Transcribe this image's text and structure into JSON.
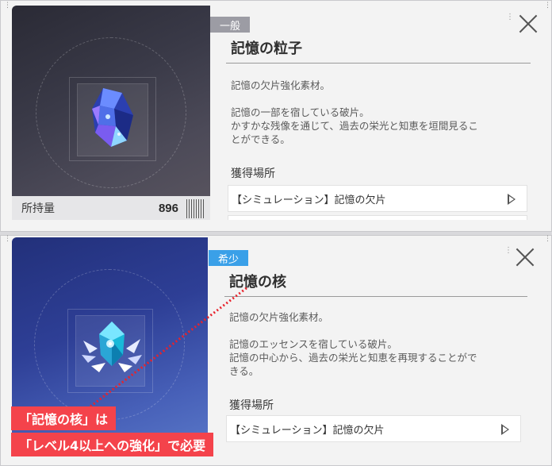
{
  "top_card": {
    "rarity": "一般",
    "title": "記憶の粒子",
    "desc_line1": "記憶の欠片強化素材。",
    "desc_line2": "記憶の一部を宿している破片。",
    "desc_line3": "かすかな残像を通じて、過去の栄光と知恵を垣間見るこ",
    "desc_line4": "とができる。",
    "source_heading": "獲得場所",
    "source_item": "【シミュレーション】記憶の欠片",
    "quantity_label": "所持量",
    "quantity_value": "896",
    "item_icon": "blue-crystal-shard-icon"
  },
  "bottom_card": {
    "rarity": "希少",
    "title": "記憶の核",
    "desc_line1": "記憶の欠片強化素材。",
    "desc_line2": "記憶のエッセンスを宿している破片。",
    "desc_line3": "記憶の中心から、過去の栄光と知恵を再現することがで",
    "desc_line4": "きる。",
    "source_heading": "獲得場所",
    "source_item": "【シミュレーション】記憶の欠片",
    "item_icon": "winged-crystal-core-icon"
  },
  "annotation": {
    "line1": "「記憶の核」は",
    "line2": "「レベル4以上への強化」で必要",
    "color": "#f4434b"
  },
  "colors": {
    "common_badge": "#9c9ca4",
    "rare_badge": "#3aa0e8"
  }
}
